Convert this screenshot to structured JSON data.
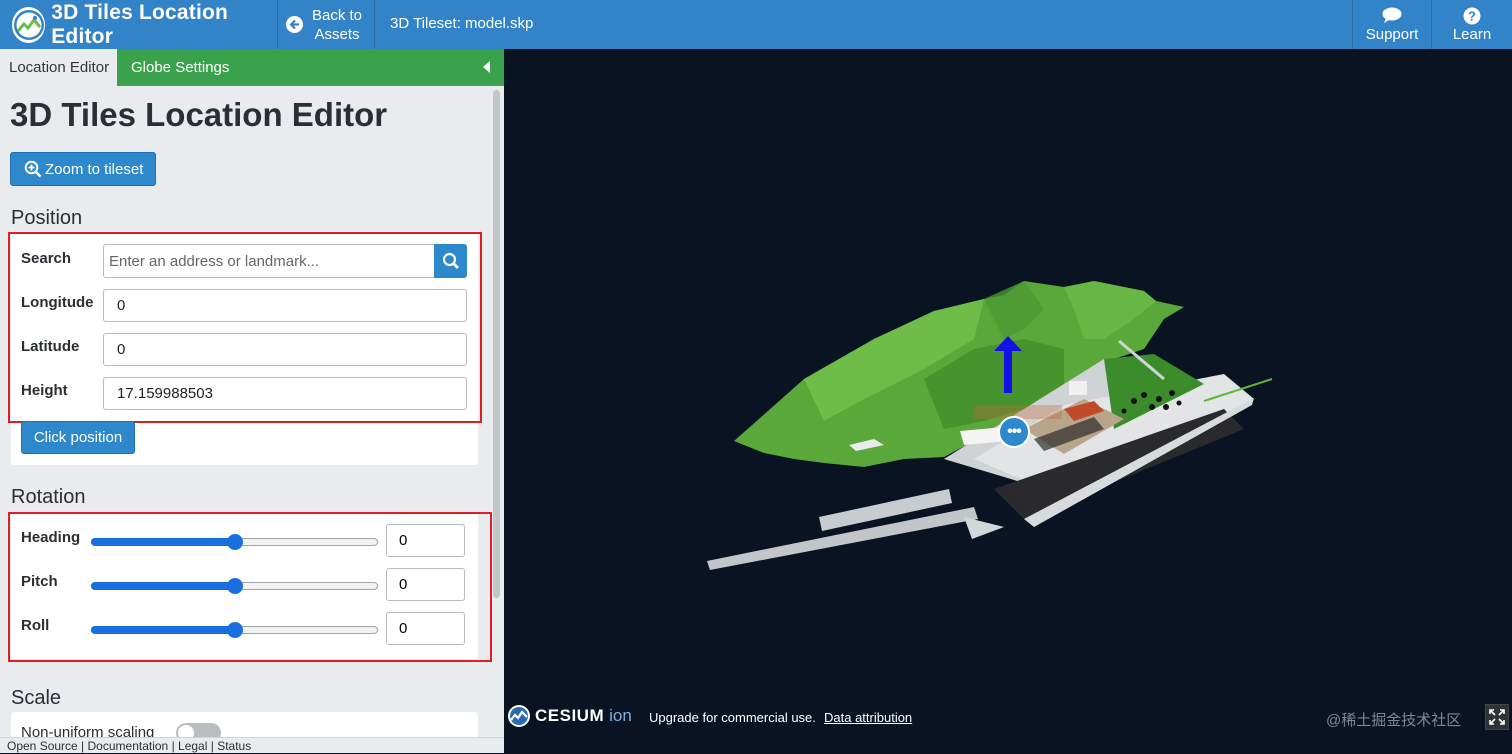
{
  "header": {
    "app_title": "3D Tiles Location Editor",
    "back_label_line1": "Back to",
    "back_label_line2": "Assets",
    "tileset_title": "3D Tileset: model.skp",
    "support_label": "Support",
    "learn_label": "Learn"
  },
  "tabs": {
    "location_editor": "Location Editor",
    "globe_settings": "Globe Settings"
  },
  "editor": {
    "title": "3D Tiles Location Editor",
    "zoom_button": "Zoom to tileset",
    "position": {
      "heading": "Position",
      "search_label": "Search",
      "search_placeholder": "Enter an address or landmark...",
      "longitude_label": "Longitude",
      "longitude_value": "0",
      "latitude_label": "Latitude",
      "latitude_value": "0",
      "height_label": "Height",
      "height_value": "17.159988503",
      "click_position_button": "Click position"
    },
    "rotation": {
      "heading": "Rotation",
      "heading_label": "Heading",
      "heading_value": "0",
      "heading_slider_fraction": 0.5,
      "pitch_label": "Pitch",
      "pitch_value": "0",
      "pitch_slider_fraction": 0.5,
      "roll_label": "Roll",
      "roll_value": "0",
      "roll_slider_fraction": 0.5
    },
    "scale": {
      "heading": "Scale",
      "non_uniform_label": "Non-uniform scaling",
      "non_uniform_enabled": false
    }
  },
  "footer": {
    "links": [
      "Open Source",
      "Documentation",
      "Legal",
      "Status"
    ]
  },
  "viewer": {
    "cesium_wordmark": "CESIUM",
    "ion_wordmark": "ion",
    "credit_text": "Upgrade for commercial use.",
    "credit_link": "Data attribution",
    "watermark": "@稀土掘金技术社区"
  },
  "colors": {
    "header_blue": "#3383c8",
    "tab_green": "#3aa24d",
    "button_blue": "#2e88cc",
    "slider_blue": "#1a6fe0",
    "highlight_red": "#e02020",
    "terrain_green": "#5aa83a"
  },
  "icons": {
    "logo": "cesium-logo-icon",
    "back": "arrow-left-circle-icon",
    "support": "chat-bubble-icon",
    "learn": "question-circle-icon",
    "zoom": "zoom-in-icon",
    "search": "search-icon",
    "collapse": "caret-left-icon",
    "fullscreen": "fullscreen-icon"
  }
}
